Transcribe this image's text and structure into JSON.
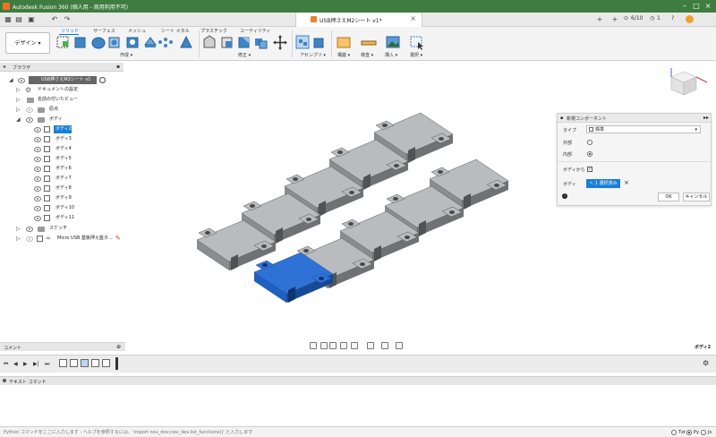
{
  "app": {
    "window_title": "Autodesk Fusion 360 (個人用 - 商用利用不可)"
  },
  "tabs": {
    "document_title": "USB押さえM2シート v1*",
    "job_status": "6/10",
    "notifications": "1"
  },
  "ribbon": {
    "workspace_button": "デザイン ▾",
    "tabs": [
      "ソリッド",
      "サーフェス",
      "メッシュ",
      "シート メタル",
      "プラスチック",
      "ユーティリティ"
    ],
    "groups": [
      "作成 ▾",
      "修正 ▾",
      "アセンブリ ▾",
      "構築 ▾",
      "検査 ▾",
      "挿入 ▾",
      "選択 ▾"
    ]
  },
  "browser": {
    "title": "ブラウザ",
    "root": "USB押さえM2シート v1",
    "items": [
      {
        "label": "ドキュメントの設定"
      },
      {
        "label": "名前の付いたビュー"
      },
      {
        "label": "原点"
      },
      {
        "label": "ボディ"
      },
      {
        "label": "ボディ2",
        "selected": true
      },
      {
        "label": "ボディ3"
      },
      {
        "label": "ボディ4"
      },
      {
        "label": "ボディ5"
      },
      {
        "label": "ボディ6"
      },
      {
        "label": "ボディ7"
      },
      {
        "label": "ボディ8"
      },
      {
        "label": "ボディ9"
      },
      {
        "label": "ボディ10"
      },
      {
        "label": "ボディ11"
      },
      {
        "label": "スケッチ"
      },
      {
        "label": "Micro USB 基板押え盤タ..."
      }
    ]
  },
  "dialog": {
    "title": "新規コンポーネント",
    "type_label": "タイプ",
    "type_value": "標準",
    "external_label": "外部",
    "internal_label": "内部",
    "from_bodies_label": "ボディから",
    "bodies_label": "ボディ",
    "selection_button": "1 選択済み",
    "ok": "OK",
    "cancel": "キャンセル"
  },
  "comments": {
    "title": "コメント"
  },
  "status": {
    "selection": "ボディ2"
  },
  "text_command": {
    "title": "テキスト コマンド",
    "placeholder": "Python コマンドをここに入力します - ヘルプを参照するには、'import neu_dev;neu_dev.list_functions()' と入力します",
    "modes": [
      "Txt",
      "Py",
      "Js"
    ],
    "active_mode": "Py"
  },
  "colors": {
    "title_bar": "#3e7d3f",
    "accent": "#0078d7",
    "selected_body": "#2f72d6",
    "body_gray": "#a7a9ac"
  }
}
